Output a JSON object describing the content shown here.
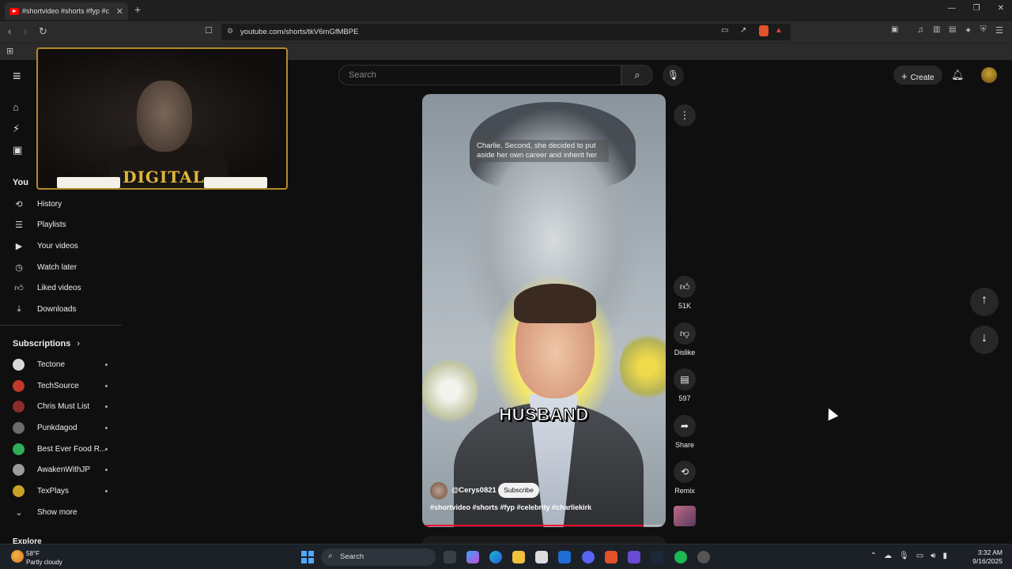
{
  "browser": {
    "tab_title": "#shortvideo #shorts #fyp #c",
    "new_tab": "+",
    "url": "youtube.com/shorts/tkV6mGfMBPE",
    "window_controls": [
      "—",
      "❐",
      "✕"
    ]
  },
  "header": {
    "search_placeholder": "Search",
    "create_label": "Create"
  },
  "sidebar": {
    "you_label": "You",
    "you_items": [
      {
        "label": "History",
        "icon": "history-icon"
      },
      {
        "label": "Playlists",
        "icon": "playlists-icon"
      },
      {
        "label": "Your videos",
        "icon": "your-videos-icon"
      },
      {
        "label": "Watch later",
        "icon": "watch-later-icon"
      },
      {
        "label": "Liked videos",
        "icon": "liked-icon"
      },
      {
        "label": "Downloads",
        "icon": "download-icon"
      }
    ],
    "subscriptions_label": "Subscriptions",
    "subscriptions": [
      {
        "name": "Tectone",
        "color": "#d9d9d9"
      },
      {
        "name": "TechSource",
        "color": "#c0392b"
      },
      {
        "name": "Chris Must List",
        "color": "#8e2b2b"
      },
      {
        "name": "Punkdagod",
        "color": "#6b6b6b"
      },
      {
        "name": "Best Ever Food R...",
        "color": "#2fae5a"
      },
      {
        "name": "AwakenWithJP",
        "color": "#9b9b9b"
      },
      {
        "name": "TexPlays",
        "color": "#c9a227"
      }
    ],
    "show_more": "Show more",
    "explore_partial": "Explore"
  },
  "webcam": {
    "brand": "DIGITAL"
  },
  "short": {
    "caption": "Charlie. Second, she decided to put aside her own career and inherit her",
    "overlay_word": "HUSBAND",
    "channel": "@Cerys0821",
    "subscribe": "Subscribe",
    "hashtags": "#shortvideo #shorts #fyp #celebrity #charliekirk",
    "progress": 0.92
  },
  "actions": {
    "like_count": "51K",
    "dislike": "Dislike",
    "comments_count": "597",
    "share": "Share",
    "remix": "Remix"
  },
  "taskbar": {
    "temperature": "58°F",
    "weather": "Partly cloudy",
    "search": "Search",
    "time": "3:32 AM",
    "date": "9/16/2025"
  }
}
